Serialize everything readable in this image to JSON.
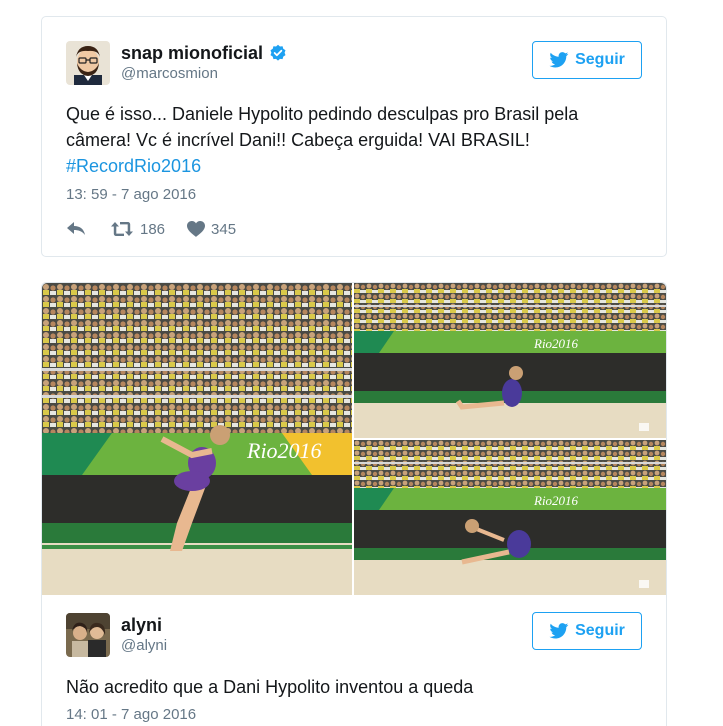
{
  "tweets": [
    {
      "display_name": "snap mionoficial",
      "verified": true,
      "handle": "@marcosmion",
      "follow_label": "Seguir",
      "text_lines": [
        "Que é isso... Daniele Hypolito pedindo desculpas pro Brasil pela",
        "câmera! Vc é incrível Dani!! Cabeça erguida! VAI BRASIL!"
      ],
      "hashtag": "#RecordRio2016",
      "timestamp": "13: 59 - 7 ago 2016",
      "retweets": "186",
      "likes": "345"
    },
    {
      "display_name": "alyni",
      "handle": "@alyni",
      "follow_label": "Seguir",
      "text": "Não acredito que a Dani Hypolito inventou a queda",
      "timestamp": "14: 01 - 7 ago 2016",
      "media": {
        "banner_text": "Rio2016",
        "photos": [
          "gymnast-leaping-photo",
          "gymnast-seated-photo",
          "gymnast-sliding-photo"
        ]
      }
    }
  ],
  "colors": {
    "twitter_blue": "#1da1f2",
    "hashtag_blue": "#1b95e0",
    "muted_gray": "#657786",
    "border": "#e1e8ed",
    "banner_green": "#6cb33f"
  }
}
